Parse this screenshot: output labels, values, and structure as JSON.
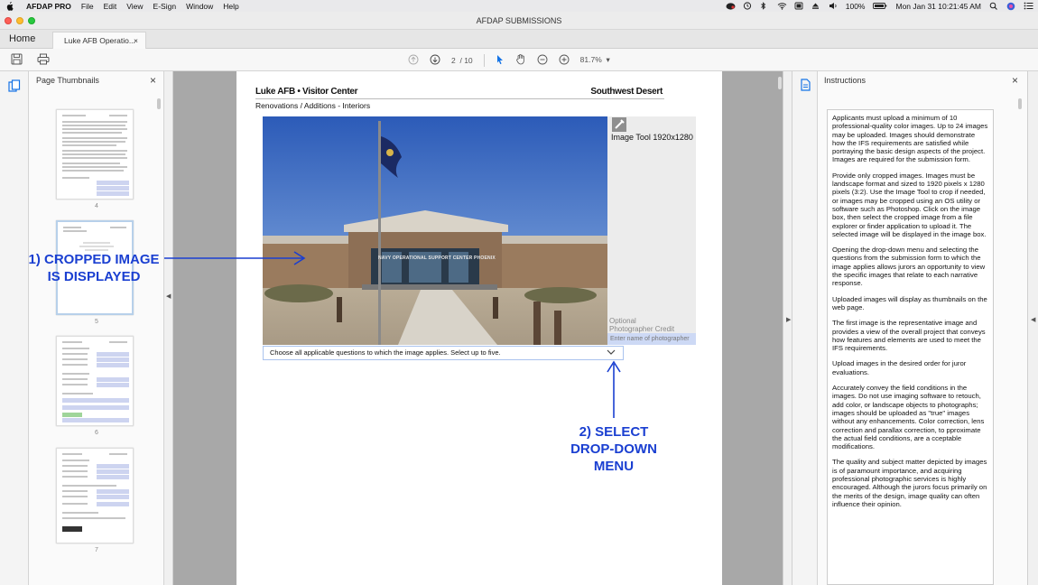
{
  "menubar": {
    "app_name": "AFDAP PRO",
    "items": [
      "File",
      "Edit",
      "View",
      "E-Sign",
      "Window",
      "Help"
    ],
    "battery": "100%",
    "clock": "Mon Jan 31  10:21:45 AM"
  },
  "window": {
    "title": "AFDAP SUBMISSIONS"
  },
  "tabs": {
    "home": "Home",
    "doc": "Luke AFB Operatio...",
    "doc_close": "×"
  },
  "toolbar": {
    "page_current": "2",
    "page_total": "/ 10",
    "zoom": "81.7%",
    "zoom_caret": "▾"
  },
  "left_panel": {
    "title": "Page Thumbnails",
    "close": "×",
    "thumb_numbers": [
      "4",
      "5",
      "6",
      "7"
    ]
  },
  "page": {
    "header_left": "Luke AFB • Visitor Center",
    "header_right": "Southwest Desert",
    "subtitle": "Renovations / Additions - Interiors",
    "photo_sign": "NAVY OPERATIONAL SUPPORT CENTER PHOENIX",
    "image_tool_label": "Image Tool 1920x1280",
    "optional_label": "Optional",
    "credit_label": "Photographer Credit",
    "credit_placeholder": "Enter name of photographer",
    "dropdown_text": "Choose all applicable questions to which the image applies. Select up to five.",
    "dropdown_chevron": "⌄"
  },
  "annotations": {
    "a1_line1": "1) CROPPED IMAGE",
    "a1_line2": "IS DISPLAYED",
    "a2_line1": "2) SELECT",
    "a2_line2": "DROP-DOWN",
    "a2_line3": "MENU"
  },
  "right_panel": {
    "title": "Instructions",
    "close": "×",
    "paragraphs": [
      "Applicants must upload a minimum of 10 professional-quality color images. Up to 24 images may be uploaded. Images should demonstrate how the IFS requirements are satisfied while portraying the basic design aspects of the project. Images are required for the submission form.",
      "Provide only cropped images. Images must be landscape format and sized to 1920 pixels x 1280 pixels (3:2). Use the Image Tool to crop if needed, or images may be cropped using an OS utility or software such as Photoshop. Click on the image box, then select the cropped image from a file explorer or finder application to upload it. The selected image will be displayed in the image box.",
      "Opening the drop-down menu and selecting the questions from the submission form to which the image applies allows jurors an opportunity to view the specific images that relate to each narrative response.",
      "Uploaded images will display as thumbnails on the web page.",
      "The first image is the representative image and provides a view of the overall project that conveys how features and elements are used to meet the IFS requirements.",
      "Upload images in the desired order for juror evaluations.",
      "Accurately convey the field conditions in the images. Do not use imaging software to retouch, add color, or landscape objects to photographs; images should be uploaded as \"true\" images without any enhancements. Color correction, lens correction and parallax correction, to pproximate the actual field conditions, are a cceptable modifications.",
      "The quality and subject matter depicted by images is of paramount importance, and acquiring professional photographic services is highly encouraged. Although the jurors focus primarily on the merits of the design, image quality can often influence their opinion."
    ]
  },
  "colors": {
    "annotation": "#1a3fd1",
    "sky": "#4a78c5",
    "field_fill": "#cdd9f5"
  }
}
